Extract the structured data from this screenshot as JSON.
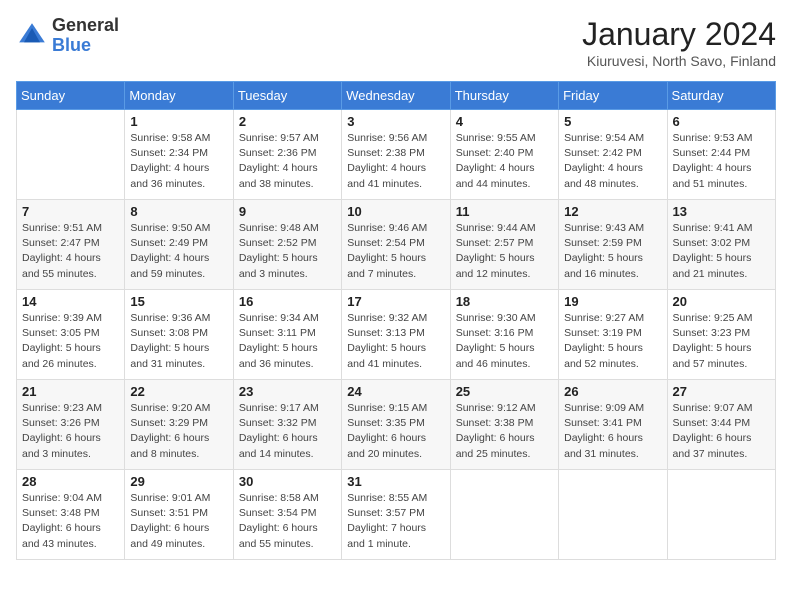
{
  "logo": {
    "general": "General",
    "blue": "Blue"
  },
  "title": "January 2024",
  "location": "Kiuruvesi, North Savo, Finland",
  "days_of_week": [
    "Sunday",
    "Monday",
    "Tuesday",
    "Wednesday",
    "Thursday",
    "Friday",
    "Saturday"
  ],
  "weeks": [
    [
      {
        "day": "",
        "info": ""
      },
      {
        "day": "1",
        "info": "Sunrise: 9:58 AM\nSunset: 2:34 PM\nDaylight: 4 hours\nand 36 minutes."
      },
      {
        "day": "2",
        "info": "Sunrise: 9:57 AM\nSunset: 2:36 PM\nDaylight: 4 hours\nand 38 minutes."
      },
      {
        "day": "3",
        "info": "Sunrise: 9:56 AM\nSunset: 2:38 PM\nDaylight: 4 hours\nand 41 minutes."
      },
      {
        "day": "4",
        "info": "Sunrise: 9:55 AM\nSunset: 2:40 PM\nDaylight: 4 hours\nand 44 minutes."
      },
      {
        "day": "5",
        "info": "Sunrise: 9:54 AM\nSunset: 2:42 PM\nDaylight: 4 hours\nand 48 minutes."
      },
      {
        "day": "6",
        "info": "Sunrise: 9:53 AM\nSunset: 2:44 PM\nDaylight: 4 hours\nand 51 minutes."
      }
    ],
    [
      {
        "day": "7",
        "info": "Sunrise: 9:51 AM\nSunset: 2:47 PM\nDaylight: 4 hours\nand 55 minutes."
      },
      {
        "day": "8",
        "info": "Sunrise: 9:50 AM\nSunset: 2:49 PM\nDaylight: 4 hours\nand 59 minutes."
      },
      {
        "day": "9",
        "info": "Sunrise: 9:48 AM\nSunset: 2:52 PM\nDaylight: 5 hours\nand 3 minutes."
      },
      {
        "day": "10",
        "info": "Sunrise: 9:46 AM\nSunset: 2:54 PM\nDaylight: 5 hours\nand 7 minutes."
      },
      {
        "day": "11",
        "info": "Sunrise: 9:44 AM\nSunset: 2:57 PM\nDaylight: 5 hours\nand 12 minutes."
      },
      {
        "day": "12",
        "info": "Sunrise: 9:43 AM\nSunset: 2:59 PM\nDaylight: 5 hours\nand 16 minutes."
      },
      {
        "day": "13",
        "info": "Sunrise: 9:41 AM\nSunset: 3:02 PM\nDaylight: 5 hours\nand 21 minutes."
      }
    ],
    [
      {
        "day": "14",
        "info": "Sunrise: 9:39 AM\nSunset: 3:05 PM\nDaylight: 5 hours\nand 26 minutes."
      },
      {
        "day": "15",
        "info": "Sunrise: 9:36 AM\nSunset: 3:08 PM\nDaylight: 5 hours\nand 31 minutes."
      },
      {
        "day": "16",
        "info": "Sunrise: 9:34 AM\nSunset: 3:11 PM\nDaylight: 5 hours\nand 36 minutes."
      },
      {
        "day": "17",
        "info": "Sunrise: 9:32 AM\nSunset: 3:13 PM\nDaylight: 5 hours\nand 41 minutes."
      },
      {
        "day": "18",
        "info": "Sunrise: 9:30 AM\nSunset: 3:16 PM\nDaylight: 5 hours\nand 46 minutes."
      },
      {
        "day": "19",
        "info": "Sunrise: 9:27 AM\nSunset: 3:19 PM\nDaylight: 5 hours\nand 52 minutes."
      },
      {
        "day": "20",
        "info": "Sunrise: 9:25 AM\nSunset: 3:23 PM\nDaylight: 5 hours\nand 57 minutes."
      }
    ],
    [
      {
        "day": "21",
        "info": "Sunrise: 9:23 AM\nSunset: 3:26 PM\nDaylight: 6 hours\nand 3 minutes."
      },
      {
        "day": "22",
        "info": "Sunrise: 9:20 AM\nSunset: 3:29 PM\nDaylight: 6 hours\nand 8 minutes."
      },
      {
        "day": "23",
        "info": "Sunrise: 9:17 AM\nSunset: 3:32 PM\nDaylight: 6 hours\nand 14 minutes."
      },
      {
        "day": "24",
        "info": "Sunrise: 9:15 AM\nSunset: 3:35 PM\nDaylight: 6 hours\nand 20 minutes."
      },
      {
        "day": "25",
        "info": "Sunrise: 9:12 AM\nSunset: 3:38 PM\nDaylight: 6 hours\nand 25 minutes."
      },
      {
        "day": "26",
        "info": "Sunrise: 9:09 AM\nSunset: 3:41 PM\nDaylight: 6 hours\nand 31 minutes."
      },
      {
        "day": "27",
        "info": "Sunrise: 9:07 AM\nSunset: 3:44 PM\nDaylight: 6 hours\nand 37 minutes."
      }
    ],
    [
      {
        "day": "28",
        "info": "Sunrise: 9:04 AM\nSunset: 3:48 PM\nDaylight: 6 hours\nand 43 minutes."
      },
      {
        "day": "29",
        "info": "Sunrise: 9:01 AM\nSunset: 3:51 PM\nDaylight: 6 hours\nand 49 minutes."
      },
      {
        "day": "30",
        "info": "Sunrise: 8:58 AM\nSunset: 3:54 PM\nDaylight: 6 hours\nand 55 minutes."
      },
      {
        "day": "31",
        "info": "Sunrise: 8:55 AM\nSunset: 3:57 PM\nDaylight: 7 hours\nand 1 minute."
      },
      {
        "day": "",
        "info": ""
      },
      {
        "day": "",
        "info": ""
      },
      {
        "day": "",
        "info": ""
      }
    ]
  ]
}
